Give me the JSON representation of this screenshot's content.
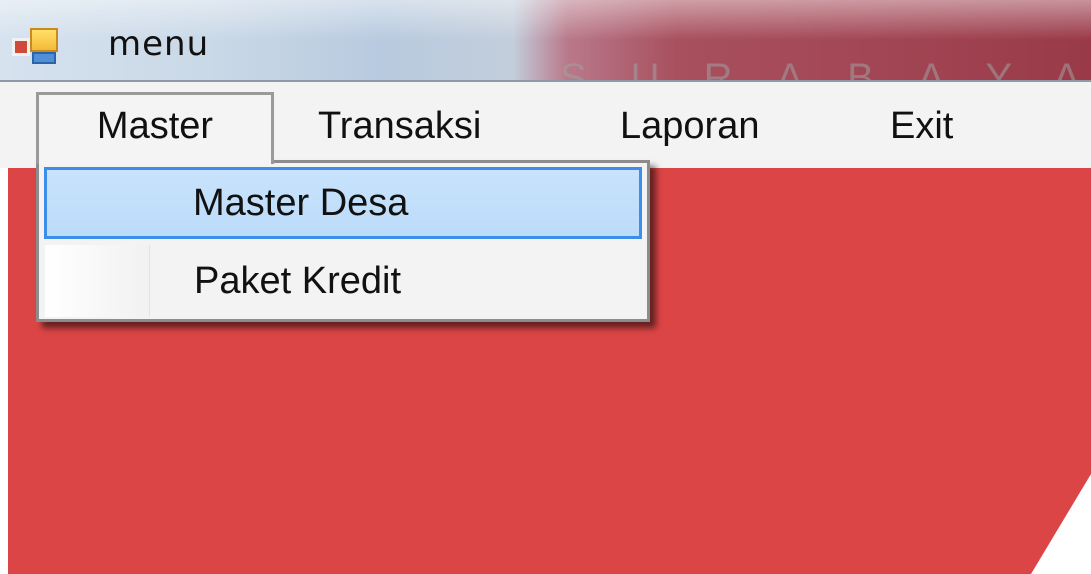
{
  "window": {
    "title": "menu",
    "icon": "app-window-icon"
  },
  "watermark": "SURABAYA",
  "menubar": {
    "items": [
      {
        "label": "Master"
      },
      {
        "label": "Transaksi"
      },
      {
        "label": "Laporan"
      },
      {
        "label": "Exit"
      }
    ]
  },
  "dropdown": {
    "items": [
      {
        "label": "Master Desa",
        "selected": true
      },
      {
        "label": "Paket Kredit",
        "selected": false
      }
    ]
  },
  "colors": {
    "client_background": "#dc4546",
    "highlight": "#c8e2fb",
    "highlight_border": "#3d8ee8"
  }
}
